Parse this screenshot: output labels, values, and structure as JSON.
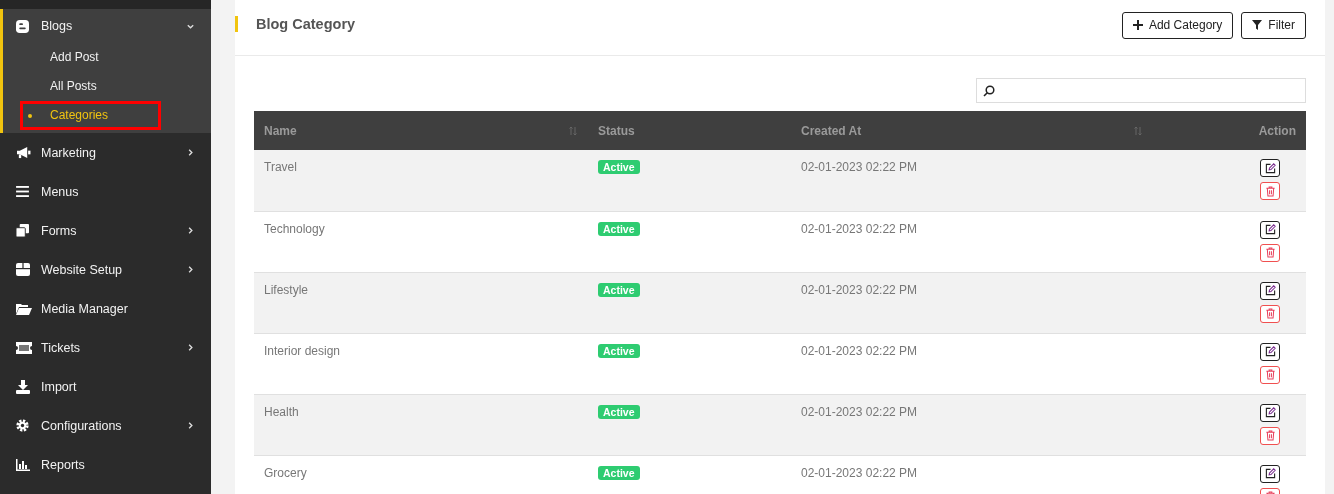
{
  "sidebar": {
    "items": [
      {
        "label": "Blogs",
        "expanded": true,
        "has_children": true,
        "children": [
          {
            "label": "Add Post",
            "selected": false,
            "highlighted": false
          },
          {
            "label": "All Posts",
            "selected": false,
            "highlighted": false
          },
          {
            "label": "Categories",
            "selected": true,
            "highlighted": true
          }
        ]
      },
      {
        "label": "Marketing",
        "expanded": false,
        "has_children": true
      },
      {
        "label": "Menus",
        "expanded": false,
        "has_children": false
      },
      {
        "label": "Forms",
        "expanded": false,
        "has_children": true
      },
      {
        "label": "Website Setup",
        "expanded": false,
        "has_children": true
      },
      {
        "label": "Media Manager",
        "expanded": false,
        "has_children": false
      },
      {
        "label": "Tickets",
        "expanded": false,
        "has_children": true
      },
      {
        "label": "Import",
        "expanded": false,
        "has_children": false
      },
      {
        "label": "Configurations",
        "expanded": false,
        "has_children": true
      },
      {
        "label": "Reports",
        "expanded": false,
        "has_children": false
      }
    ]
  },
  "page": {
    "title": "Blog Category",
    "buttons": [
      "Add Category",
      "Filter"
    ]
  },
  "table": {
    "columns": [
      {
        "label": "Name",
        "sortable": true
      },
      {
        "label": "Status",
        "sortable": false
      },
      {
        "label": "Created At",
        "sortable": true
      },
      {
        "label": "Action",
        "sortable": false
      }
    ],
    "rows": [
      {
        "name": "Travel",
        "status": "Active",
        "created_at": "02-01-2023 02:22 PM"
      },
      {
        "name": "Technology",
        "status": "Active",
        "created_at": "02-01-2023 02:22 PM"
      },
      {
        "name": "Lifestyle",
        "status": "Active",
        "created_at": "02-01-2023 02:22 PM"
      },
      {
        "name": "Interior design",
        "status": "Active",
        "created_at": "02-01-2023 02:22 PM"
      },
      {
        "name": "Health",
        "status": "Active",
        "created_at": "02-01-2023 02:22 PM"
      },
      {
        "name": "Grocery",
        "status": "Active",
        "created_at": "02-01-2023 02:22 PM"
      }
    ]
  }
}
